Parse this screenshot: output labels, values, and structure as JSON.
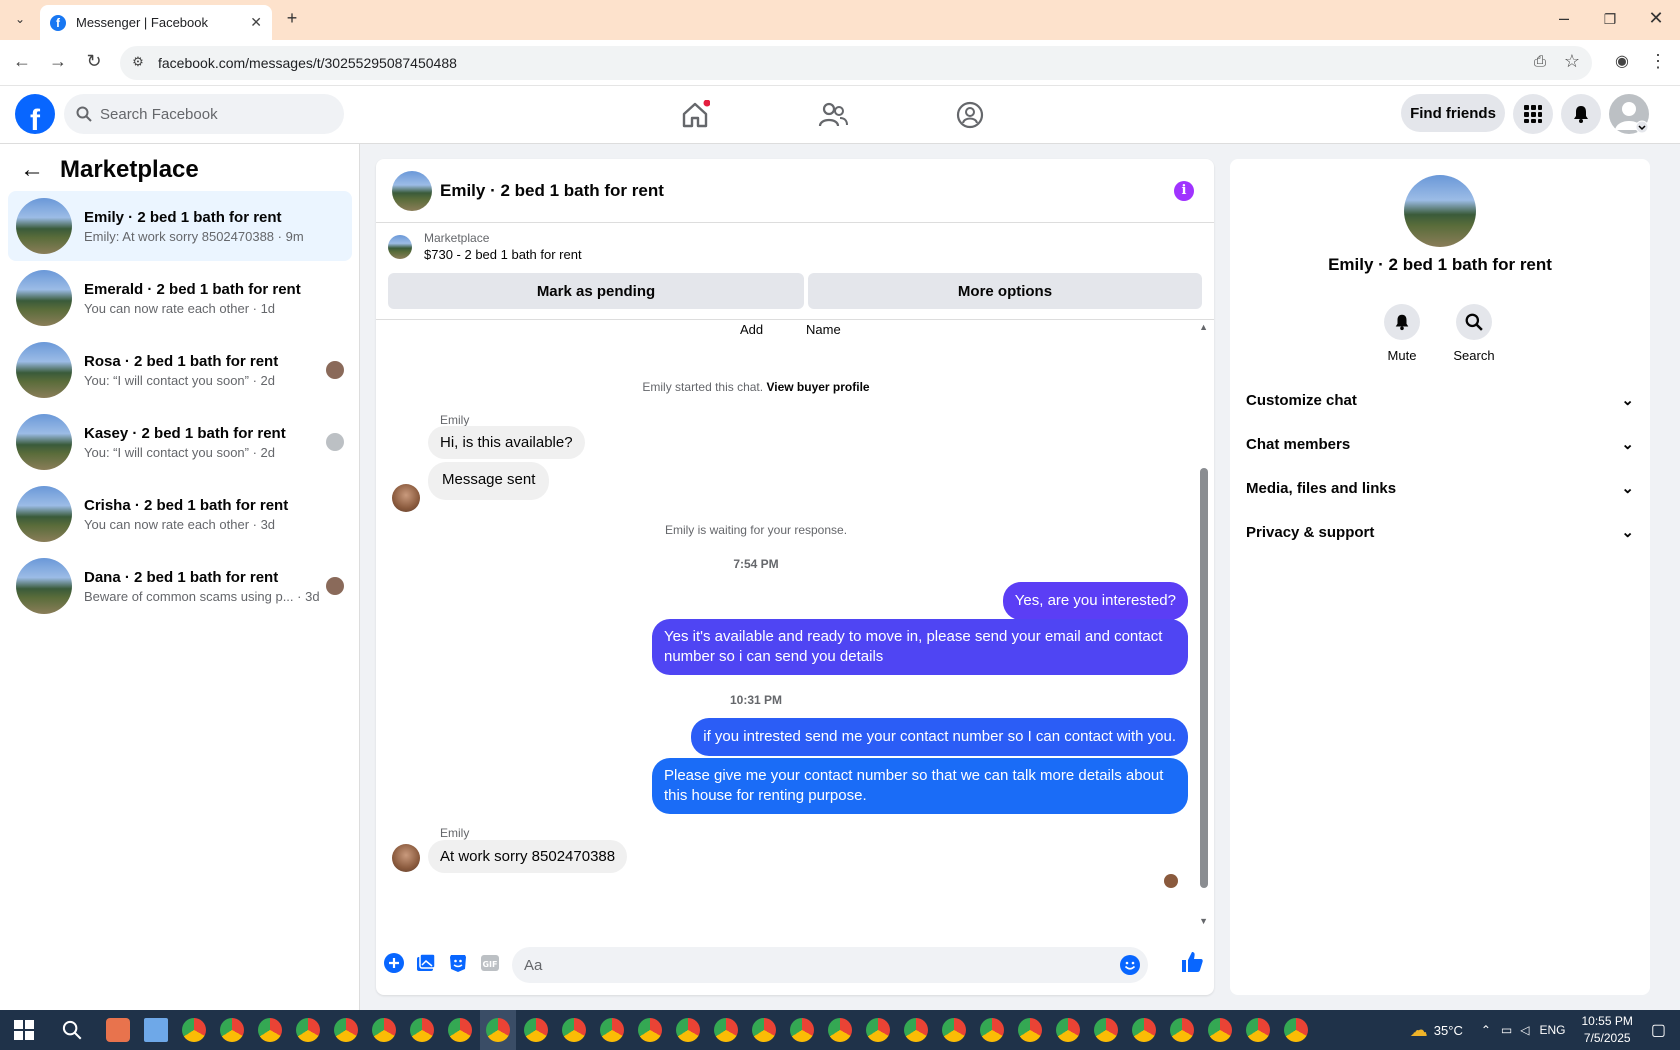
{
  "browser": {
    "tab_title": "Messenger | Facebook",
    "url": "facebook.com/messages/t/30255295087450488"
  },
  "header": {
    "search_placeholder": "Search Facebook",
    "find_friends": "Find friends"
  },
  "left": {
    "title": "Marketplace",
    "conversations": [
      {
        "name": "Emily · 2 bed 1 bath for rent",
        "sub": "Emily: At work sorry 8502470388 · 9m"
      },
      {
        "name": "Emerald · 2 bed 1 bath for rent",
        "sub": "You can now rate each other · 1d"
      },
      {
        "name": "Rosa · 2 bed 1 bath for rent",
        "sub": "You: “I will contact you soon” · 2d"
      },
      {
        "name": "Kasey · 2 bed 1 bath for rent",
        "sub": "You: “I will contact you soon” · 2d"
      },
      {
        "name": "Crisha · 2 bed 1 bath for rent",
        "sub": "You can now rate each other · 3d"
      },
      {
        "name": "Dana · 2 bed 1 bath for rent",
        "sub": "Beware of common scams using p... · 3d"
      }
    ]
  },
  "chat": {
    "title": "Emily · 2 bed 1 bath for rent",
    "listing_label": "Marketplace",
    "listing_price": "$730 - 2 bed 1 bath for rent",
    "mark_pending": "Mark as pending",
    "more_options": "More options",
    "partial_add": "Add",
    "partial_name": "Name",
    "started_text": "Emily started this chat.",
    "view_profile": "View buyer profile",
    "sender": "Emily",
    "in_1": "Hi, is this available?",
    "in_2": "Message sent",
    "waiting": "Emily is waiting for your response.",
    "time_1": "7:54 PM",
    "out_1": "Yes, are you interested?",
    "out_2": "Yes it's available and ready to move in, please send your email and contact number so i can send you details",
    "time_2": "10:31 PM",
    "out_3": "if you intrested send me your contact number so I can contact with you.",
    "out_4": "Please give me your contact number so that we can talk more details about this house for renting purpose.",
    "in_3": "At work sorry 8502470388",
    "input_placeholder": "Aa",
    "out_color": "#5b3ef5",
    "out_color_2": "#1a6cf7"
  },
  "right": {
    "name": "Emily · 2 bed 1 bath for rent",
    "mute": "Mute",
    "search": "Search",
    "sections": [
      "Customize chat",
      "Chat members",
      "Media, files and links",
      "Privacy & support"
    ]
  },
  "taskbar": {
    "temp": "35°C",
    "lang": "ENG",
    "time": "10:55 PM",
    "date": "7/5/2025"
  }
}
